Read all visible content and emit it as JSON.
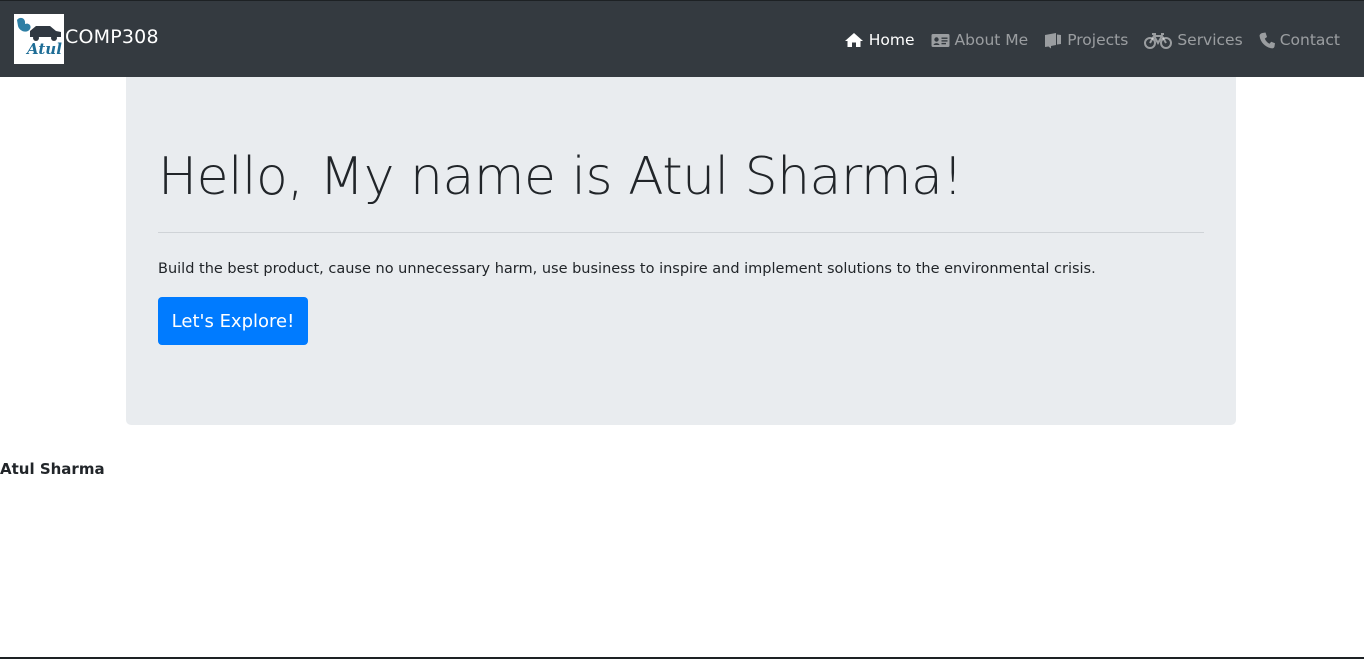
{
  "navbar": {
    "brand": "COMP308",
    "logo_text": "Atul",
    "items": [
      {
        "label": "Home",
        "icon": "home-icon",
        "active": true
      },
      {
        "label": "About Me",
        "icon": "id-card-icon",
        "active": false
      },
      {
        "label": "Projects",
        "icon": "projects-icon",
        "active": false
      },
      {
        "label": "Services",
        "icon": "bicycle-icon",
        "active": false
      },
      {
        "label": "Contact",
        "icon": "phone-icon",
        "active": false
      }
    ]
  },
  "jumbotron": {
    "heading": "Hello, My name is Atul Sharma!",
    "lead": "Build the best product, cause no unnecessary harm, use business to inspire and implement solutions to the environmental crisis.",
    "button_label": "Let's Explore!"
  },
  "footer": {
    "name": "Atul Sharma"
  },
  "colors": {
    "navbar_bg": "#343a40",
    "jumbotron_bg": "#e9ecef",
    "primary": "#007bff"
  }
}
